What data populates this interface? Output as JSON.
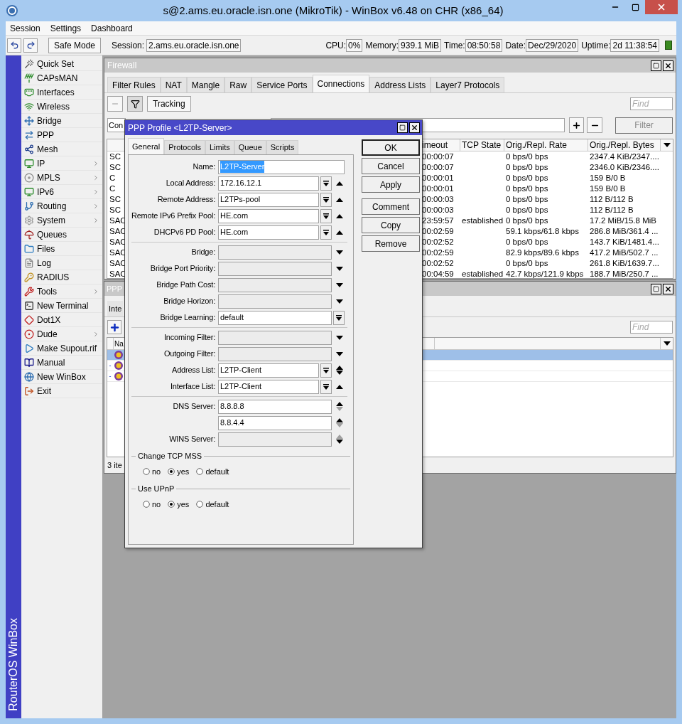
{
  "window": {
    "title": "s@2.ams.eu.oracle.isn.one (MikroTik) - WinBox v6.48 on CHR (x86_64)"
  },
  "menu": [
    "Session",
    "Settings",
    "Dashboard"
  ],
  "toolbar": {
    "safe_mode": "Safe Mode",
    "session_label": "Session:",
    "session": "2.ams.eu.oracle.isn.one",
    "stats": [
      {
        "label": "CPU:",
        "value": "0%"
      },
      {
        "label": "Memory:",
        "value": "939.1 MiB"
      },
      {
        "label": "Time:",
        "value": "08:50:58"
      },
      {
        "label": "Date:",
        "value": "Dec/29/2020"
      },
      {
        "label": "Uptime:",
        "value": "2d 11:38:54"
      }
    ]
  },
  "sidebar": {
    "brand": "RouterOS WinBox",
    "items": [
      {
        "label": "Quick Set",
        "submenu": false
      },
      {
        "label": "CAPsMAN",
        "submenu": false
      },
      {
        "label": "Interfaces",
        "submenu": false
      },
      {
        "label": "Wireless",
        "submenu": false
      },
      {
        "label": "Bridge",
        "submenu": false
      },
      {
        "label": "PPP",
        "submenu": false
      },
      {
        "label": "Mesh",
        "submenu": false
      },
      {
        "label": "IP",
        "submenu": true
      },
      {
        "label": "MPLS",
        "submenu": true
      },
      {
        "label": "IPv6",
        "submenu": true
      },
      {
        "label": "Routing",
        "submenu": true
      },
      {
        "label": "System",
        "submenu": true
      },
      {
        "label": "Queues",
        "submenu": false
      },
      {
        "label": "Files",
        "submenu": false
      },
      {
        "label": "Log",
        "submenu": false
      },
      {
        "label": "RADIUS",
        "submenu": false
      },
      {
        "label": "Tools",
        "submenu": true
      },
      {
        "label": "New Terminal",
        "submenu": false
      },
      {
        "label": "Dot1X",
        "submenu": false
      },
      {
        "label": "Dude",
        "submenu": true
      },
      {
        "label": "Make Supout.rif",
        "submenu": false
      },
      {
        "label": "Manual",
        "submenu": false
      },
      {
        "label": "New WinBox",
        "submenu": false
      },
      {
        "label": "Exit",
        "submenu": false
      }
    ]
  },
  "firewall": {
    "title": "Firewall",
    "tabs": [
      {
        "label": "Filter Rules",
        "selected": false
      },
      {
        "label": "NAT",
        "selected": false
      },
      {
        "label": "Mangle",
        "selected": false
      },
      {
        "label": "Raw",
        "selected": false
      },
      {
        "label": "Service Ports",
        "selected": false
      },
      {
        "label": "Connections",
        "selected": true
      },
      {
        "label": "Address Lists",
        "selected": false
      },
      {
        "label": "Layer7 Protocols",
        "selected": false
      }
    ],
    "tracking": "Tracking",
    "find_placeholder": "Find",
    "filter_field": "Con",
    "filter_button": "Filter",
    "columns": [
      "",
      "imeout",
      "TCP State",
      "Orig./Repl. Rate",
      "Orig./Repl. Bytes"
    ],
    "rows": [
      [
        "SC",
        "00:00:07",
        "",
        "0 bps/0 bps",
        "2347.4 KiB/2347...."
      ],
      [
        "SC",
        "00:00:07",
        "",
        "0 bps/0 bps",
        "2346.0 KiB/2346...."
      ],
      [
        "C",
        "00:00:01",
        "",
        "0 bps/0 bps",
        "159 B/0 B"
      ],
      [
        "C",
        "00:00:01",
        "",
        "0 bps/0 bps",
        "159 B/0 B"
      ],
      [
        "SC",
        "00:00:03",
        "",
        "0 bps/0 bps",
        "112 B/112 B"
      ],
      [
        "SC",
        "00:00:03",
        "",
        "0 bps/0 bps",
        "112 B/112 B"
      ],
      [
        "SAC",
        "23:59:57",
        "established",
        "0 bps/0 bps",
        "17.2 MiB/15.8 MiB"
      ],
      [
        "SAC",
        "00:02:59",
        "",
        "59.1 kbps/61.8 kbps",
        "286.8 MiB/361.4 ..."
      ],
      [
        "SAC",
        "00:02:52",
        "",
        "0 bps/0 bps",
        "143.7 KiB/1481.4..."
      ],
      [
        "SAC",
        "00:02:59",
        "",
        "82.9 kbps/89.6 kbps",
        "417.2 MiB/502.7 ..."
      ],
      [
        "SAC",
        "00:02:52",
        "",
        "0 bps/0 bps",
        "261.8 KiB/1639.7..."
      ],
      [
        "SAC",
        "00:04:59",
        "established",
        "42.7 kbps/121.9 kbps",
        "188.7 MiB/250.7 ..."
      ]
    ]
  },
  "ppp": {
    "title": "PPP",
    "tab": "Inte",
    "find_placeholder": "Find",
    "column": "Na",
    "status": "3 ite",
    "rows": [
      {
        "selected": true
      },
      {
        "flag": "-",
        "selected": false
      },
      {
        "flag": "-",
        "selected": false
      }
    ]
  },
  "dialog": {
    "title": "PPP Profile <L2TP-Server>",
    "tabs": [
      {
        "label": "General",
        "selected": true
      },
      {
        "label": "Protocols",
        "selected": false
      },
      {
        "label": "Limits",
        "selected": false
      },
      {
        "label": "Queue",
        "selected": false
      },
      {
        "label": "Scripts",
        "selected": false
      }
    ],
    "button_groups": [
      [
        "OK",
        "Cancel",
        "Apply"
      ],
      [
        "Comment",
        "Copy",
        "Remove"
      ]
    ],
    "sections": [
      [
        {
          "label": "Name:",
          "value": "L2TP-Server",
          "kind": "text",
          "value_selected": true,
          "disabled": false
        },
        {
          "label": "Local Address:",
          "value": "172.16.12.1",
          "kind": "combo_up",
          "disabled": false
        },
        {
          "label": "Remote Address:",
          "value": "L2TPs-pool",
          "kind": "combo_up",
          "disabled": false
        },
        {
          "label": "Remote IPv6 Prefix Pool:",
          "value": "HE.com",
          "kind": "combo_up",
          "disabled": false
        },
        {
          "label": "DHCPv6 PD Pool:",
          "value": "HE.com",
          "kind": "combo_up",
          "disabled": false
        }
      ],
      [
        {
          "label": "Bridge:",
          "kind": "dropdown_down",
          "disabled": true
        },
        {
          "label": "Bridge Port Priority:",
          "kind": "dropdown_down",
          "disabled": true
        },
        {
          "label": "Bridge Path Cost:",
          "kind": "dropdown_down",
          "disabled": true
        },
        {
          "label": "Bridge Horizon:",
          "kind": "dropdown_down",
          "disabled": true
        },
        {
          "label": "Bridge Learning:",
          "value": "default",
          "kind": "select",
          "disabled": false
        }
      ],
      [
        {
          "label": "Incoming Filter:",
          "kind": "dropdown_down",
          "disabled": true
        },
        {
          "label": "Outgoing Filter:",
          "kind": "dropdown_down",
          "disabled": true
        },
        {
          "label": "Address List:",
          "value": "L2TP-Client",
          "kind": "combo_spin",
          "disabled": false
        },
        {
          "label": "Interface List:",
          "value": "L2TP-Client",
          "kind": "combo_up",
          "disabled": false
        }
      ],
      [
        {
          "label": "DNS Server:",
          "value": "8.8.8.8",
          "kind": "spin_up",
          "disabled": false
        },
        {
          "value": "8.8.4.4",
          "kind": "spin_up",
          "disabled": false
        },
        {
          "label": "WINS Server:",
          "kind": "spin_down",
          "disabled": true
        }
      ]
    ],
    "radio_groups": [
      {
        "title": "Change TCP MSS",
        "options": [
          {
            "label": "no",
            "selected": false
          },
          {
            "label": "yes",
            "selected": true
          },
          {
            "label": "default",
            "selected": false
          }
        ]
      },
      {
        "title": "Use UPnP",
        "options": [
          {
            "label": "no",
            "selected": false
          },
          {
            "label": "yes",
            "selected": true
          },
          {
            "label": "default",
            "selected": false
          }
        ]
      }
    ]
  }
}
